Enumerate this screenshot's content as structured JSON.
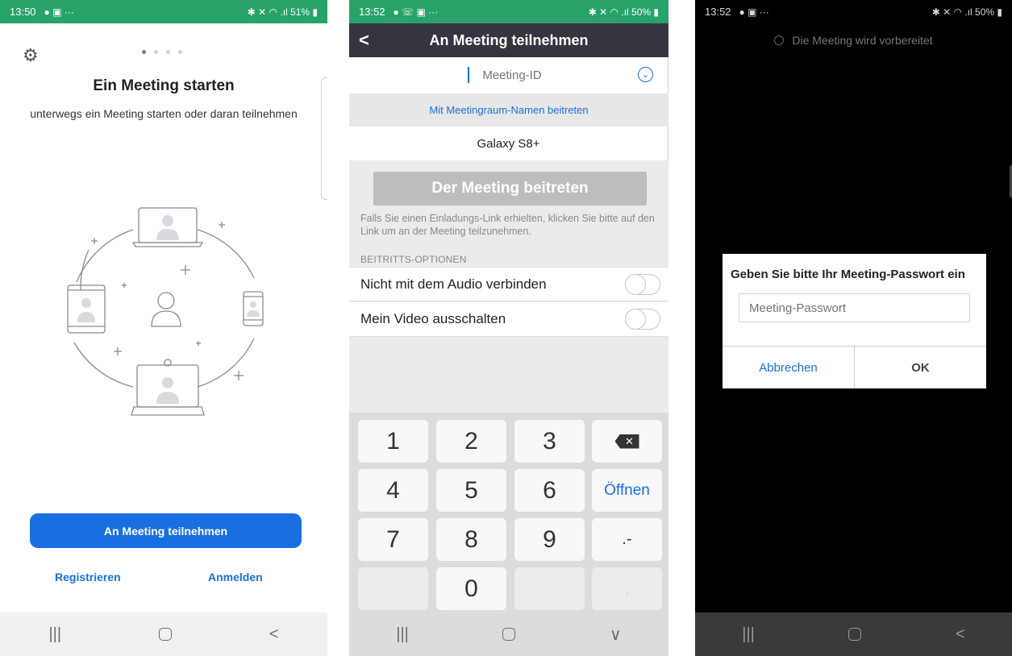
{
  "colors": {
    "status_green": "#27a36a",
    "accent_blue": "#1a6fe0",
    "header_dark": "#35353f"
  },
  "phone1": {
    "status": {
      "time": "13:50",
      "right": "51%"
    },
    "title": "Ein Meeting starten",
    "subtitle": "unterwegs ein Meeting starten oder daran teilnehmen",
    "join_button": "An Meeting teilnehmen",
    "register_link": "Registrieren",
    "signin_link": "Anmelden",
    "nav": {
      "recents": "|||",
      "back": "<"
    }
  },
  "phone2": {
    "status": {
      "time": "13:52",
      "right": "50%"
    },
    "header_title": "An Meeting teilnehmen",
    "back_icon": "<",
    "meeting_id_placeholder": "Meeting-ID",
    "room_name_link": "Mit Meetingraum-Namen beitreten",
    "device_name": "Galaxy S8+",
    "join_button": "Der Meeting beitreten",
    "hint": "Falls Sie einen Einladungs-Link erhielten, klicken Sie bitte auf den Link um an der Meeting teilzunehmen.",
    "options_label": "BEITRITTS-OPTIONEN",
    "options": [
      {
        "label": "Nicht mit dem Audio verbinden"
      },
      {
        "label": "Mein Video ausschalten"
      }
    ],
    "keys": {
      "k1": "1",
      "k2": "2",
      "k3": "3",
      "k4": "4",
      "k5": "5",
      "k6": "6",
      "k7": "7",
      "k8": "8",
      "k9": "9",
      "k0": "0",
      "open": "Öffnen",
      "punct": ".-",
      "comma": ","
    },
    "nav": {
      "recents": "|||",
      "hide": "∨"
    }
  },
  "phone3": {
    "status": {
      "time": "13:52",
      "right": "50%"
    },
    "preparing": "Die Meeting wird vorbereitet",
    "dialog_title": "Geben Sie bitte Ihr Meeting-Passwort ein",
    "password_placeholder": "Meeting-Passwort",
    "cancel": "Abbrechen",
    "ok": "OK",
    "nav": {
      "recents": "|||",
      "back": "<"
    }
  }
}
